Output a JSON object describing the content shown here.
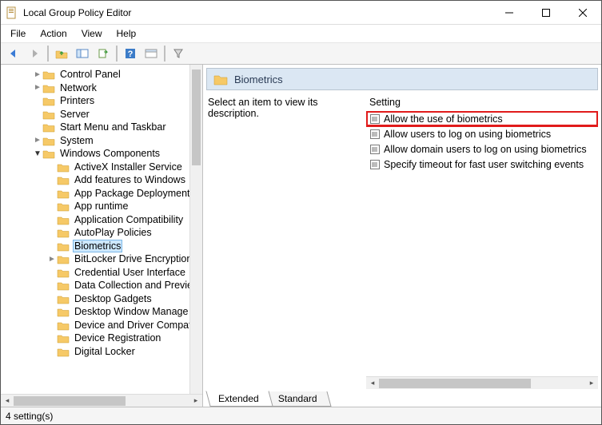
{
  "app": {
    "title": "Local Group Policy Editor"
  },
  "menu": {
    "file": "File",
    "action": "Action",
    "view": "View",
    "help": "Help"
  },
  "tree": {
    "items": [
      {
        "indent": 40,
        "exp": ">",
        "label": "Control Panel"
      },
      {
        "indent": 40,
        "exp": ">",
        "label": "Network"
      },
      {
        "indent": 40,
        "exp": "",
        "label": "Printers"
      },
      {
        "indent": 40,
        "exp": "",
        "label": "Server"
      },
      {
        "indent": 40,
        "exp": "",
        "label": "Start Menu and Taskbar"
      },
      {
        "indent": 40,
        "exp": ">",
        "label": "System"
      },
      {
        "indent": 40,
        "exp": "v",
        "label": "Windows Components"
      },
      {
        "indent": 58,
        "exp": "",
        "label": "ActiveX Installer Service"
      },
      {
        "indent": 58,
        "exp": "",
        "label": "Add features to Windows"
      },
      {
        "indent": 58,
        "exp": "",
        "label": "App Package Deployment"
      },
      {
        "indent": 58,
        "exp": "",
        "label": "App runtime"
      },
      {
        "indent": 58,
        "exp": "",
        "label": "Application Compatibility"
      },
      {
        "indent": 58,
        "exp": "",
        "label": "AutoPlay Policies"
      },
      {
        "indent": 58,
        "exp": "",
        "label": "Biometrics",
        "selected": true
      },
      {
        "indent": 58,
        "exp": ">",
        "label": "BitLocker Drive Encryption"
      },
      {
        "indent": 58,
        "exp": "",
        "label": "Credential User Interface"
      },
      {
        "indent": 58,
        "exp": "",
        "label": "Data Collection and Previe"
      },
      {
        "indent": 58,
        "exp": "",
        "label": "Desktop Gadgets"
      },
      {
        "indent": 58,
        "exp": "",
        "label": "Desktop Window Manage"
      },
      {
        "indent": 58,
        "exp": "",
        "label": "Device and Driver Compat"
      },
      {
        "indent": 58,
        "exp": "",
        "label": "Device Registration"
      },
      {
        "indent": 58,
        "exp": "",
        "label": "Digital Locker"
      }
    ]
  },
  "right": {
    "header": "Biometrics",
    "description": "Select an item to view its description.",
    "list_header": "Setting",
    "items": [
      {
        "label": "Allow the use of biometrics",
        "highlight": true
      },
      {
        "label": "Allow users to log on using biometrics"
      },
      {
        "label": "Allow domain users to log on using biometrics"
      },
      {
        "label": "Specify timeout for fast user switching events"
      }
    ]
  },
  "tabs": {
    "extended": "Extended",
    "standard": "Standard"
  },
  "status": {
    "text": "4 setting(s)"
  }
}
